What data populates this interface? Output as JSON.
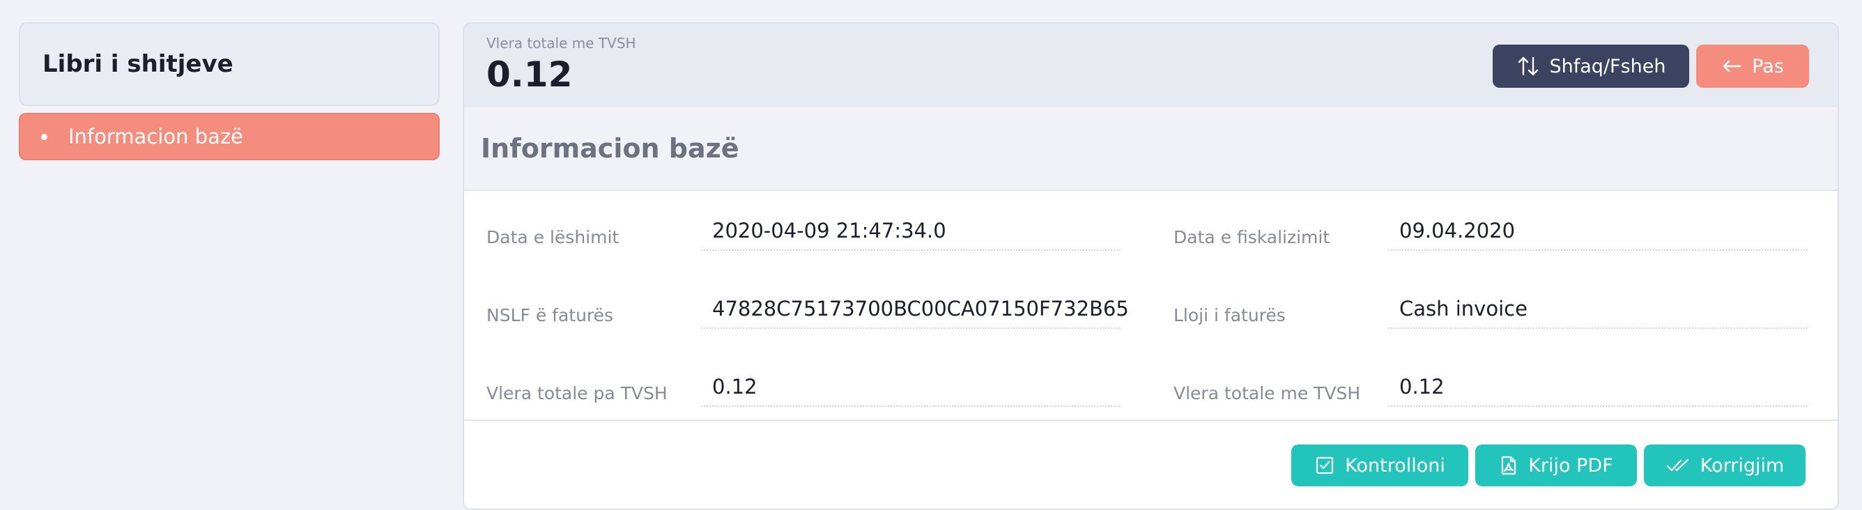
{
  "sidebar": {
    "title": "Libri i shitjeve",
    "items": [
      {
        "label": "Informacion bazë",
        "active": true
      }
    ]
  },
  "header": {
    "caption": "Vlera totale me TVSH",
    "total": "0.12",
    "toggle_label": "Shfaq/Fsheh",
    "back_label": "Pas"
  },
  "section": {
    "title": "Informacion bazë",
    "fields": [
      {
        "label": "Data e lëshimit",
        "value": "2020-04-09 21:47:34.0"
      },
      {
        "label": "Data e fiskalizimit",
        "value": "09.04.2020"
      },
      {
        "label": "NSLF ë faturës",
        "value": "47828C75173700BC00CA07150F732B65"
      },
      {
        "label": "Lloji i faturës",
        "value": "Cash invoice"
      },
      {
        "label": "Vlera totale pa TVSH",
        "value": "0.12"
      },
      {
        "label": "Vlera totale me TVSH",
        "value": "0.12"
      }
    ]
  },
  "actions": {
    "check_label": "Kontrolloni",
    "pdf_label": "Krijo PDF",
    "correct_label": "Korrigjim"
  },
  "colors": {
    "accent_salmon": "#f58d7f",
    "accent_teal": "#23c4bb",
    "dark_button": "#3c4360"
  },
  "icons": {
    "toggle": "sort-arrows-icon",
    "back": "arrow-left-icon",
    "check": "checkbox-icon",
    "pdf": "pdf-file-icon",
    "correct": "double-check-icon"
  }
}
